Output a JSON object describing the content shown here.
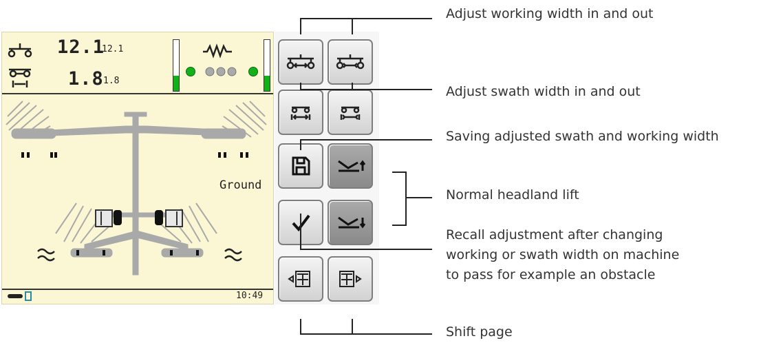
{
  "terminal": {
    "working_width": {
      "value": "12.1",
      "sub": "12.1"
    },
    "swath_width": {
      "value": "1.8",
      "sub": "1.8"
    },
    "status_label": "Ground",
    "clock": "10:49"
  },
  "annotations": {
    "adjust_working_width": "Adjust working width in and out",
    "adjust_swath_width": "Adjust swath width in and out",
    "saving": "Saving adjusted swath and working width",
    "normal_headland_lift": "Normal headland lift",
    "recall_line1": "Recall adjustment after changing",
    "recall_line2": "working or swath width on machine",
    "recall_line3": "to pass for example an obstacle",
    "shift_page": "Shift page"
  },
  "colors": {
    "screen_bg": "#fbf7d5",
    "indicator_green": "#13b01b",
    "rake_gray": "#a9a9a9"
  },
  "icons": {
    "buttons": [
      "working-width-out-icon",
      "working-width-in-icon",
      "swath-width-out-icon",
      "swath-width-in-icon",
      "save-icon",
      "headland-lift-up-icon",
      "checkmark-icon",
      "headland-lift-down-icon",
      "page-left-icon",
      "page-right-icon"
    ]
  }
}
